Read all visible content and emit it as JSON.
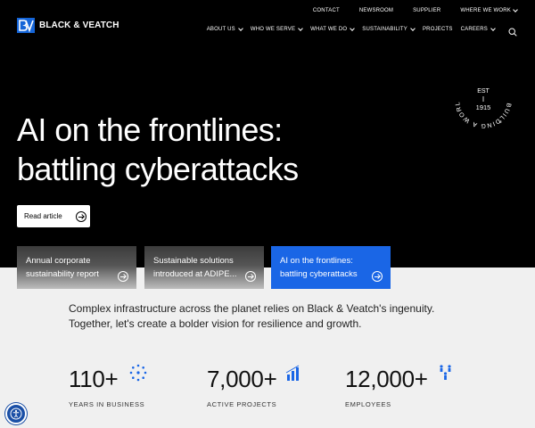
{
  "brand": {
    "name": "BLACK & VEATCH",
    "mark": "BV"
  },
  "utility_nav": [
    {
      "label": "CONTACT",
      "has_menu": false
    },
    {
      "label": "NEWSROOM",
      "has_menu": false
    },
    {
      "label": "SUPPLIER",
      "has_menu": false
    },
    {
      "label": "WHERE WE WORK",
      "has_menu": true
    }
  ],
  "main_nav": [
    {
      "label": "ABOUT US"
    },
    {
      "label": "WHO WE SERVE"
    },
    {
      "label": "WHAT WE DO"
    },
    {
      "label": "SUSTAINABILITY"
    },
    {
      "label": "PROJECTS"
    },
    {
      "label": "CAREERS"
    }
  ],
  "hero": {
    "title_line1": "AI on the frontlines:",
    "title_line2": "battling cyberattacks",
    "cta": "Read article"
  },
  "badge": {
    "ring_text": "BUILDING A WORLD OF DIFFERENCE",
    "est": "EST",
    "year": "1915",
    "reg": "®"
  },
  "cards": [
    {
      "line1": "Annual corporate",
      "line2": "sustainability report",
      "active": false
    },
    {
      "line1": "Sustainable solutions",
      "line2": "introduced at ADIPE...",
      "active": false
    },
    {
      "line1": "AI on the frontlines:",
      "line2": "battling cyberattacks",
      "active": true
    }
  ],
  "intro": "Complex infrastructure across the planet relies on Black & Veatch's ingenuity. Together, let's create a bolder vision for resilience and growth.",
  "stats": [
    {
      "value": "110+",
      "label": "YEARS IN BUSINESS",
      "icon": "clock-dots-icon"
    },
    {
      "value": "7,000+",
      "label": "ACTIVE PROJECTS",
      "icon": "bar-chart-icon"
    },
    {
      "value": "12,000+",
      "label": "EMPLOYEES",
      "icon": "people-icon"
    }
  ],
  "colors": {
    "accent": "#1a66e6",
    "hero_bg": "#000000",
    "page_bg": "#f0f0f0"
  }
}
